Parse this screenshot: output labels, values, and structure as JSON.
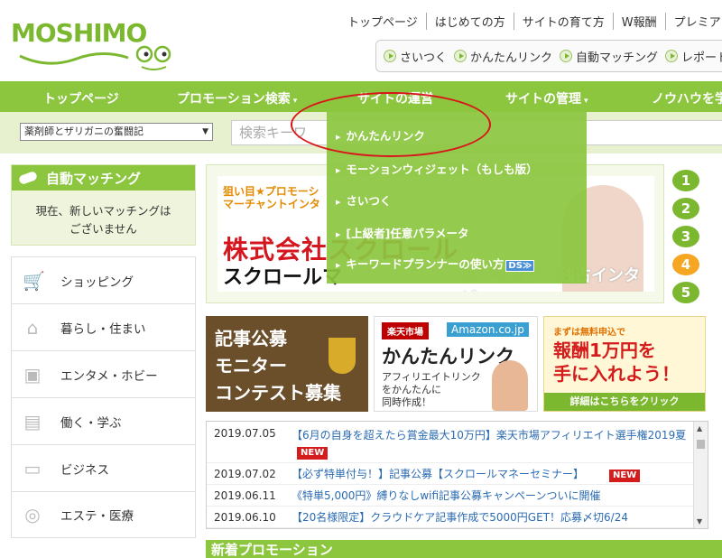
{
  "logo": {
    "text": "MOSHIMO"
  },
  "top_links": [
    "トップページ",
    "はじめての方",
    "サイトの育て方",
    "W報酬",
    "プレミア"
  ],
  "sub_links": [
    "さいつく",
    "かんたんリンク",
    "自動マッチング",
    "レポート"
  ],
  "nav": [
    {
      "label": "トップページ",
      "caret": ""
    },
    {
      "label": "プロモーション検索",
      "caret": "▾"
    },
    {
      "label": "サイトの運営",
      "caret": ""
    },
    {
      "label": "サイトの管理",
      "caret": "▾"
    },
    {
      "label": "ノウハウを学",
      "caret": ""
    }
  ],
  "search": {
    "site_select": "薬剤師とザリガニの奮闘記",
    "placeholder": "検索キーワ"
  },
  "dropdown": {
    "items": [
      "かんたんリンク",
      "モーションウィジェット（もしも版）",
      "さいつく",
      "[上級者]任意パラメータ",
      "キーワードプランナーの使い方"
    ],
    "ds_badge": "DS≫"
  },
  "side_match": {
    "title": "自動マッチング",
    "line1": "現在、新しいマッチングは",
    "line2": "ございません"
  },
  "categories": [
    {
      "label": "ショッピング",
      "icon": "cart-icon"
    },
    {
      "label": "暮らし・住まい",
      "icon": "house-icon"
    },
    {
      "label": "エンタメ・ホビー",
      "icon": "cards-icon"
    },
    {
      "label": "働く・学ぶ",
      "icon": "desk-icon"
    },
    {
      "label": "ビジネス",
      "icon": "briefcase-icon"
    },
    {
      "label": "エステ・医療",
      "icon": "mirror-icon"
    }
  ],
  "banner": {
    "tag_line1": "狙い目★プロモーシ",
    "tag_line2": "マーチャントインタ",
    "red_text": "株式会社スクロール",
    "black_text": "スクロールマ",
    "sub_text": "ネーセミナー独占インタビュー"
  },
  "banner_nums": [
    "1",
    "2",
    "3",
    "4",
    "5"
  ],
  "tiles": {
    "contest_line1": "記事公募",
    "contest_line2": "モニター",
    "contest_line3": "コンテスト募集",
    "rakuten": "楽天市場",
    "amazon": "Amazon.co.jp",
    "easy_title": "かんたんリンク",
    "easy_desc1": "アフィリエイトリンク",
    "easy_desc2": "をかんたんに",
    "easy_desc3": "同時作成！",
    "reward_small": "まずは無料申込で",
    "reward_line1": "報酬1万円を",
    "reward_line2": "手に入れよう！",
    "reward_link": "詳細はこちらをクリック"
  },
  "news": [
    {
      "date": "2019.07.05",
      "title": "【6月の自身を超えたら賞金最大10万円】楽天市場アフィリエイト選手権2019夏",
      "badge": "NEW"
    },
    {
      "date": "2019.07.02",
      "title": "【必ず特単付与！】記事公募【スクロールマネーセミナー】",
      "badge": "NEW"
    },
    {
      "date": "2019.06.11",
      "title": "《特単5,000円》縛りなしwifi記事公募キャンペーンついに開催",
      "badge": ""
    },
    {
      "date": "2019.06.10",
      "title": "【20名様限定】クラウドケア記事作成で5000円GET！応募〆切6/24",
      "badge": ""
    }
  ],
  "new_promo_title": "新着プロモーション",
  "colors": {
    "brand_green": "#8cc63f",
    "annotation_red": "#d8151b",
    "link_blue": "#2b6bb2"
  }
}
